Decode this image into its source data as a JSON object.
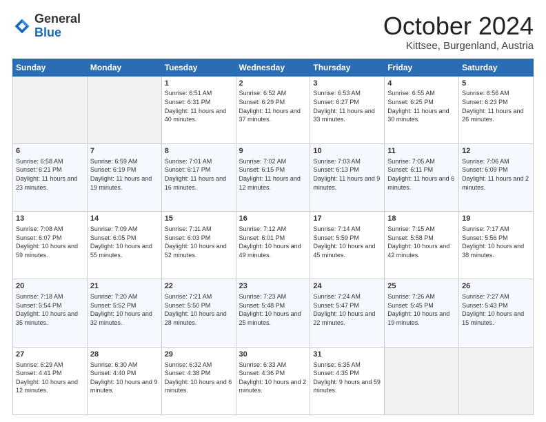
{
  "header": {
    "logo": {
      "general": "General",
      "blue": "Blue"
    },
    "title": "October 2024",
    "subtitle": "Kittsee, Burgenland, Austria"
  },
  "weekdays": [
    "Sunday",
    "Monday",
    "Tuesday",
    "Wednesday",
    "Thursday",
    "Friday",
    "Saturday"
  ],
  "weeks": [
    [
      {
        "day": "",
        "info": ""
      },
      {
        "day": "",
        "info": ""
      },
      {
        "day": "1",
        "info": "Sunrise: 6:51 AM\nSunset: 6:31 PM\nDaylight: 11 hours and 40 minutes."
      },
      {
        "day": "2",
        "info": "Sunrise: 6:52 AM\nSunset: 6:29 PM\nDaylight: 11 hours and 37 minutes."
      },
      {
        "day": "3",
        "info": "Sunrise: 6:53 AM\nSunset: 6:27 PM\nDaylight: 11 hours and 33 minutes."
      },
      {
        "day": "4",
        "info": "Sunrise: 6:55 AM\nSunset: 6:25 PM\nDaylight: 11 hours and 30 minutes."
      },
      {
        "day": "5",
        "info": "Sunrise: 6:56 AM\nSunset: 6:23 PM\nDaylight: 11 hours and 26 minutes."
      }
    ],
    [
      {
        "day": "6",
        "info": "Sunrise: 6:58 AM\nSunset: 6:21 PM\nDaylight: 11 hours and 23 minutes."
      },
      {
        "day": "7",
        "info": "Sunrise: 6:59 AM\nSunset: 6:19 PM\nDaylight: 11 hours and 19 minutes."
      },
      {
        "day": "8",
        "info": "Sunrise: 7:01 AM\nSunset: 6:17 PM\nDaylight: 11 hours and 16 minutes."
      },
      {
        "day": "9",
        "info": "Sunrise: 7:02 AM\nSunset: 6:15 PM\nDaylight: 11 hours and 12 minutes."
      },
      {
        "day": "10",
        "info": "Sunrise: 7:03 AM\nSunset: 6:13 PM\nDaylight: 11 hours and 9 minutes."
      },
      {
        "day": "11",
        "info": "Sunrise: 7:05 AM\nSunset: 6:11 PM\nDaylight: 11 hours and 6 minutes."
      },
      {
        "day": "12",
        "info": "Sunrise: 7:06 AM\nSunset: 6:09 PM\nDaylight: 11 hours and 2 minutes."
      }
    ],
    [
      {
        "day": "13",
        "info": "Sunrise: 7:08 AM\nSunset: 6:07 PM\nDaylight: 10 hours and 59 minutes."
      },
      {
        "day": "14",
        "info": "Sunrise: 7:09 AM\nSunset: 6:05 PM\nDaylight: 10 hours and 55 minutes."
      },
      {
        "day": "15",
        "info": "Sunrise: 7:11 AM\nSunset: 6:03 PM\nDaylight: 10 hours and 52 minutes."
      },
      {
        "day": "16",
        "info": "Sunrise: 7:12 AM\nSunset: 6:01 PM\nDaylight: 10 hours and 49 minutes."
      },
      {
        "day": "17",
        "info": "Sunrise: 7:14 AM\nSunset: 5:59 PM\nDaylight: 10 hours and 45 minutes."
      },
      {
        "day": "18",
        "info": "Sunrise: 7:15 AM\nSunset: 5:58 PM\nDaylight: 10 hours and 42 minutes."
      },
      {
        "day": "19",
        "info": "Sunrise: 7:17 AM\nSunset: 5:56 PM\nDaylight: 10 hours and 38 minutes."
      }
    ],
    [
      {
        "day": "20",
        "info": "Sunrise: 7:18 AM\nSunset: 5:54 PM\nDaylight: 10 hours and 35 minutes."
      },
      {
        "day": "21",
        "info": "Sunrise: 7:20 AM\nSunset: 5:52 PM\nDaylight: 10 hours and 32 minutes."
      },
      {
        "day": "22",
        "info": "Sunrise: 7:21 AM\nSunset: 5:50 PM\nDaylight: 10 hours and 28 minutes."
      },
      {
        "day": "23",
        "info": "Sunrise: 7:23 AM\nSunset: 5:48 PM\nDaylight: 10 hours and 25 minutes."
      },
      {
        "day": "24",
        "info": "Sunrise: 7:24 AM\nSunset: 5:47 PM\nDaylight: 10 hours and 22 minutes."
      },
      {
        "day": "25",
        "info": "Sunrise: 7:26 AM\nSunset: 5:45 PM\nDaylight: 10 hours and 19 minutes."
      },
      {
        "day": "26",
        "info": "Sunrise: 7:27 AM\nSunset: 5:43 PM\nDaylight: 10 hours and 15 minutes."
      }
    ],
    [
      {
        "day": "27",
        "info": "Sunrise: 6:29 AM\nSunset: 4:41 PM\nDaylight: 10 hours and 12 minutes."
      },
      {
        "day": "28",
        "info": "Sunrise: 6:30 AM\nSunset: 4:40 PM\nDaylight: 10 hours and 9 minutes."
      },
      {
        "day": "29",
        "info": "Sunrise: 6:32 AM\nSunset: 4:38 PM\nDaylight: 10 hours and 6 minutes."
      },
      {
        "day": "30",
        "info": "Sunrise: 6:33 AM\nSunset: 4:36 PM\nDaylight: 10 hours and 2 minutes."
      },
      {
        "day": "31",
        "info": "Sunrise: 6:35 AM\nSunset: 4:35 PM\nDaylight: 9 hours and 59 minutes."
      },
      {
        "day": "",
        "info": ""
      },
      {
        "day": "",
        "info": ""
      }
    ]
  ]
}
